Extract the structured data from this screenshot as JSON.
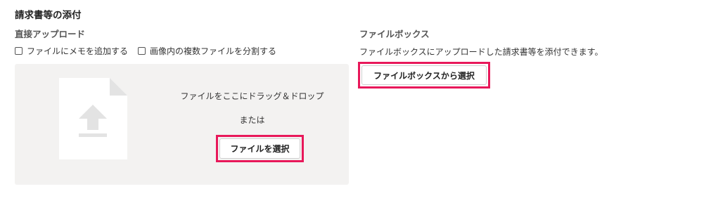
{
  "section": {
    "title": "請求書等の添付"
  },
  "direct_upload": {
    "heading": "直接アップロード",
    "options": [
      {
        "label": "ファイルにメモを追加する",
        "checked": false
      },
      {
        "label": "画像内の複数ファイルを分割する",
        "checked": false
      }
    ],
    "dropzone": {
      "main_text": "ファイルをここにドラッグ＆ドロップ",
      "or_text": "または",
      "select_button": "ファイルを選択"
    }
  },
  "filebox": {
    "heading": "ファイルボックス",
    "description": "ファイルボックスにアップロードした請求書等を添付できます。",
    "select_button": "ファイルボックスから選択"
  },
  "colors": {
    "highlight": "#e8185a",
    "dropzone_bg": "#f3f2f1",
    "icon": "#e6e6e6"
  }
}
